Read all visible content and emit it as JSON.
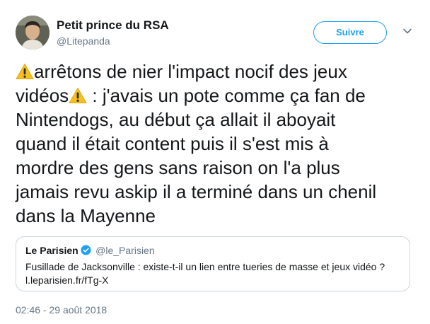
{
  "author": {
    "display_name": "Petit prince du RSA",
    "handle": "@Litepanda",
    "avatar_icon": "profile-photo"
  },
  "actions": {
    "follow_label": "Suivre",
    "menu_icon": "chevron-down-icon"
  },
  "tweet": {
    "line_1": "arrêtons de nier l'impact nocif des jeux",
    "line_2_start": "vidéos",
    "line_2_end": " : j'avais un pote comme ça fan de",
    "line_3": "Nintendogs, au début ça allait il aboyait",
    "line_4": "quand il était content puis il s'est mis à",
    "line_5": "mordre des gens sans raison on l'a plus",
    "line_6": "jamais revu askip il a terminé dans un chenil",
    "line_7": "dans la Mayenne",
    "emoji": "warning-sign"
  },
  "quoted_tweet": {
    "name": "Le Parisien",
    "handle": "@le_Parisien",
    "verified": true,
    "text": "Fusillade de Jacksonville : existe-t-il un lien entre tueries de masse et jeux vidéo ?",
    "link": "l.leparisien.fr/fTg-X"
  },
  "timestamp": "02:46 - 29 août 2018",
  "colors": {
    "accent": "#1da1f2",
    "muted": "#657786",
    "text": "#14171a",
    "border": "#ccd6dd"
  }
}
